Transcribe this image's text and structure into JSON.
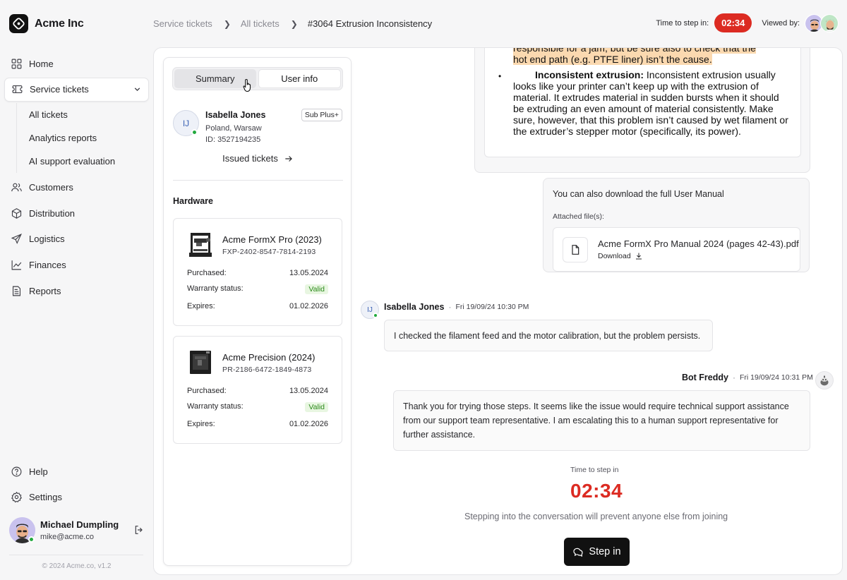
{
  "app": {
    "name": "Acme Inc",
    "version": "© 2024 Acme.co, v1.2"
  },
  "sidebar": {
    "items": [
      {
        "label": "Home",
        "icon": "home-icon"
      },
      {
        "label": "Service tickets",
        "icon": "ticket-icon"
      },
      {
        "label": "Customers",
        "icon": "users-icon"
      },
      {
        "label": "Distribution",
        "icon": "package-icon"
      },
      {
        "label": "Logistics",
        "icon": "send-icon"
      },
      {
        "label": "Finances",
        "icon": "chart-line-icon"
      },
      {
        "label": "Reports",
        "icon": "report-icon"
      }
    ],
    "subitems": [
      "All tickets",
      "Analytics reports",
      "AI support evaluation"
    ],
    "bottom": [
      {
        "label": "Help",
        "icon": "help-icon"
      },
      {
        "label": "Settings",
        "icon": "gear-icon"
      }
    ],
    "user": {
      "name": "Michael Dumpling",
      "email": "mike@acme.co"
    }
  },
  "breadcrumb": [
    "Service tickets",
    "All tickets",
    "#3064 Extrusion Inconsistency"
  ],
  "header": {
    "timer_label": "Time to step in:",
    "timer": "02:34",
    "viewed_label": "Viewed by:"
  },
  "info": {
    "tabs": [
      "Summary",
      "User info"
    ],
    "user": {
      "initials": "IJ",
      "name": "Isabella Jones",
      "location": "Poland, Warsaw",
      "id": "ID: 3527194235",
      "plan": "Sub Plus+"
    },
    "issued_tickets": "Issued tickets",
    "hardware_title": "Hardware",
    "hardware": [
      {
        "name": "Acme FormX Pro (2023)",
        "serial": "FXP-2402-8547-7814-2193",
        "purchased_label": "Purchased:",
        "purchased": "13.05.2024",
        "warranty_label": "Warranty status:",
        "warranty": "Valid",
        "expires_label": "Expires:",
        "expires": "01.02.2026"
      },
      {
        "name": "Acme Precision (2024)",
        "serial": "PR-2186-6472-1849-4873",
        "purchased_label": "Purchased:",
        "purchased": "13.05.2024",
        "warranty_label": "Warranty status:",
        "warranty": "Valid",
        "expires_label": "Expires:",
        "expires": "01.02.2026"
      }
    ]
  },
  "conversation": {
    "doc_highlight": "responsible for a jam, but be sure also to check that the hot end path (e.g. PTFE liner) isn’t the cause.",
    "doc_bold": "Inconsistent extrusion:",
    "doc_text": " Inconsistent extrusion usually looks like your printer can’t keep up with the extrusion of material. It extrudes material in sudden bursts when it should be extruding an even amount of material consistently. Make sure, however, that this problem isn’t caused by wet filament or the extruder’s stepper motor (specifically, its power).",
    "manual_text": "You can also download the full User Manual",
    "attached_label": "Attached file(s):",
    "file_name": "Acme FormX Pro Manual 2024 (pages 42-43).pdf",
    "download_label": "Download",
    "messages": [
      {
        "author": "Isabella Jones",
        "initials": "IJ",
        "time": "Fri 19/09/24 10:30 PM",
        "text": "I checked the filament feed and the motor calibration, but the problem persists."
      },
      {
        "author": "Bot Freddy",
        "time": "Fri 19/09/24 10:31 PM",
        "text": "Thank you for trying those steps. It seems like the issue would require technical support assistance from our support team representative. I am escalating this to a human support representative for further assistance."
      }
    ],
    "step_label": "Time to step in",
    "step_timer": "02:34",
    "step_note": "Stepping into the conversation will prevent anyone else from joining",
    "step_button": "Step in"
  }
}
